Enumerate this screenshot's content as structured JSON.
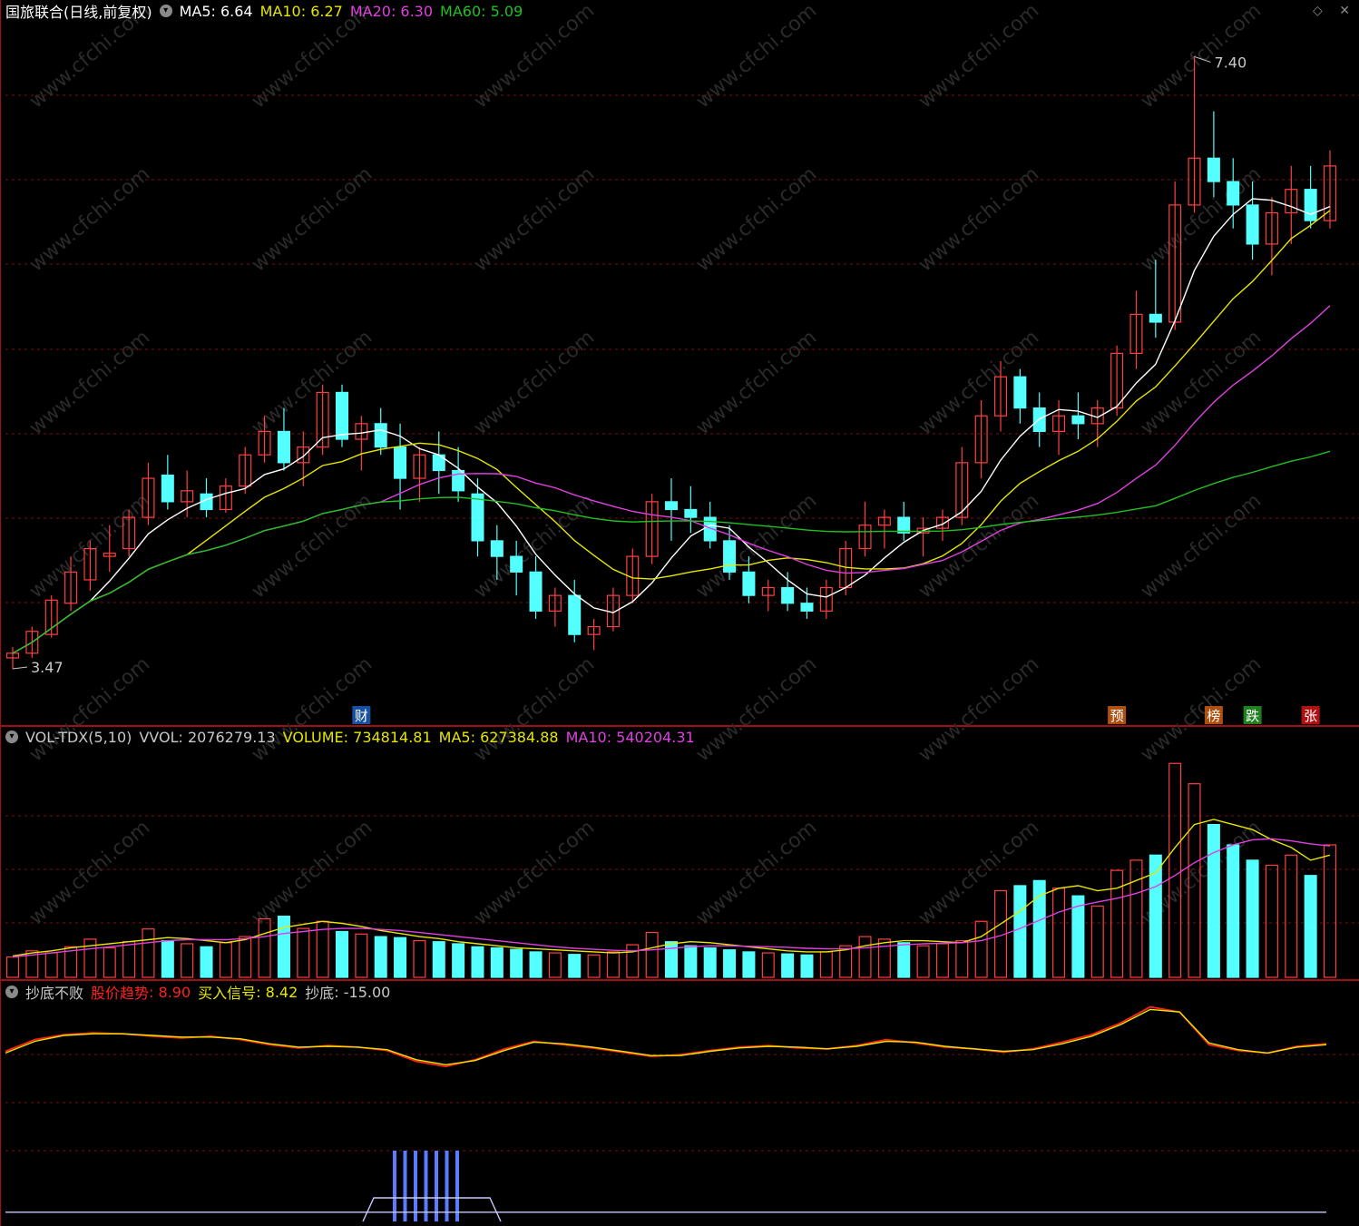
{
  "colors": {
    "up": "#ff4040",
    "down": "#54ffff",
    "ma5": "#ffffff",
    "ma10": "#e6e600",
    "ma20": "#e040e0",
    "ma60": "#20c020",
    "grid": "#7a1010",
    "trend": "#ff2020",
    "signal": "#e6e600"
  },
  "header": {
    "title": "国旅联合(日线,前复权)",
    "ma5": "MA5: 6.64",
    "ma10": "MA10: 6.27",
    "ma20": "MA20: 6.30",
    "ma60": "MA60: 5.09"
  },
  "vol_header": {
    "name": "VOL-TDX(5,10)",
    "vvol": "VVOL: 2076279.13",
    "volume": "VOLUME: 734814.81",
    "ma5": "MA5: 627384.88",
    "ma10": "MA10: 540204.31"
  },
  "ind_header": {
    "name": "抄底不败",
    "trend_label": "股价趋势",
    "trend_value": ": 8.90",
    "signal_label": "买入信号",
    "signal_value": ": 8.42",
    "bottom_label": "抄底",
    "bottom_value": ": -15.00"
  },
  "top_icons": {
    "diamond": "◇",
    "close": "✕"
  },
  "chart_data": [
    {
      "type": "candlestick",
      "high_label": "7.40",
      "low_label": "3.47",
      "candles": [
        [
          3.55,
          3.62,
          3.48,
          3.58
        ],
        [
          3.58,
          3.75,
          3.55,
          3.72
        ],
        [
          3.7,
          3.95,
          3.68,
          3.92
        ],
        [
          3.9,
          4.2,
          3.85,
          4.1
        ],
        [
          4.05,
          4.3,
          3.98,
          4.25
        ],
        [
          4.2,
          4.4,
          4.1,
          4.22
        ],
        [
          4.25,
          4.5,
          4.2,
          4.45
        ],
        [
          4.45,
          4.8,
          4.4,
          4.7
        ],
        [
          4.72,
          4.85,
          4.5,
          4.55
        ],
        [
          4.55,
          4.75,
          4.45,
          4.62
        ],
        [
          4.6,
          4.7,
          4.45,
          4.5
        ],
        [
          4.5,
          4.7,
          4.48,
          4.65
        ],
        [
          4.65,
          4.9,
          4.6,
          4.85
        ],
        [
          4.85,
          5.1,
          4.8,
          5.0
        ],
        [
          5.0,
          5.15,
          4.75,
          4.8
        ],
        [
          4.8,
          5.0,
          4.65,
          4.9
        ],
        [
          4.9,
          5.3,
          4.85,
          5.25
        ],
        [
          5.25,
          5.3,
          4.9,
          4.95
        ],
        [
          4.95,
          5.1,
          4.75,
          5.05
        ],
        [
          5.05,
          5.15,
          4.85,
          4.9
        ],
        [
          4.9,
          5.05,
          4.5,
          4.7
        ],
        [
          4.7,
          4.9,
          4.55,
          4.85
        ],
        [
          4.85,
          5.0,
          4.6,
          4.75
        ],
        [
          4.75,
          4.9,
          4.55,
          4.62
        ],
        [
          4.6,
          4.7,
          4.2,
          4.3
        ],
        [
          4.3,
          4.4,
          4.05,
          4.2
        ],
        [
          4.2,
          4.3,
          3.95,
          4.1
        ],
        [
          4.1,
          4.2,
          3.8,
          3.85
        ],
        [
          3.85,
          4.0,
          3.75,
          3.95
        ],
        [
          3.95,
          4.05,
          3.65,
          3.7
        ],
        [
          3.7,
          3.8,
          3.6,
          3.75
        ],
        [
          3.75,
          4.0,
          3.72,
          3.95
        ],
        [
          3.95,
          4.25,
          3.9,
          4.2
        ],
        [
          4.2,
          4.6,
          4.15,
          4.55
        ],
        [
          4.55,
          4.7,
          4.3,
          4.5
        ],
        [
          4.5,
          4.65,
          4.35,
          4.45
        ],
        [
          4.45,
          4.55,
          4.25,
          4.3
        ],
        [
          4.3,
          4.4,
          4.05,
          4.1
        ],
        [
          4.1,
          4.2,
          3.9,
          3.95
        ],
        [
          3.95,
          4.05,
          3.85,
          4.0
        ],
        [
          4.0,
          4.1,
          3.85,
          3.9
        ],
        [
          3.9,
          4.0,
          3.8,
          3.85
        ],
        [
          3.85,
          4.05,
          3.8,
          4.0
        ],
        [
          4.0,
          4.3,
          3.95,
          4.25
        ],
        [
          4.25,
          4.55,
          4.2,
          4.4
        ],
        [
          4.4,
          4.5,
          4.25,
          4.45
        ],
        [
          4.45,
          4.55,
          4.3,
          4.35
        ],
        [
          4.35,
          4.45,
          4.2,
          4.38
        ],
        [
          4.38,
          4.5,
          4.3,
          4.45
        ],
        [
          4.45,
          4.9,
          4.4,
          4.8
        ],
        [
          4.8,
          5.2,
          4.7,
          5.1
        ],
        [
          5.1,
          5.45,
          5.0,
          5.35
        ],
        [
          5.35,
          5.4,
          5.05,
          5.15
        ],
        [
          5.15,
          5.25,
          4.9,
          5.0
        ],
        [
          5.0,
          5.2,
          4.85,
          5.1
        ],
        [
          5.1,
          5.25,
          4.95,
          5.05
        ],
        [
          5.05,
          5.2,
          4.9,
          5.15
        ],
        [
          5.15,
          5.55,
          5.1,
          5.5
        ],
        [
          5.5,
          5.9,
          5.4,
          5.75
        ],
        [
          5.75,
          6.1,
          5.6,
          5.7
        ],
        [
          5.7,
          6.6,
          5.65,
          6.45
        ],
        [
          6.45,
          7.4,
          6.4,
          6.75
        ],
        [
          6.75,
          7.05,
          6.5,
          6.6
        ],
        [
          6.6,
          6.75,
          6.3,
          6.45
        ],
        [
          6.45,
          6.6,
          6.1,
          6.2
        ],
        [
          6.2,
          6.5,
          6.0,
          6.4
        ],
        [
          6.4,
          6.7,
          6.2,
          6.55
        ],
        [
          6.55,
          6.7,
          6.3,
          6.35
        ],
        [
          6.35,
          6.8,
          6.3,
          6.7
        ]
      ]
    },
    {
      "type": "bar",
      "volumes": [
        40,
        52,
        48,
        60,
        75,
        58,
        70,
        95,
        72,
        66,
        60,
        68,
        80,
        115,
        120,
        96,
        110,
        90,
        85,
        80,
        78,
        72,
        70,
        66,
        60,
        58,
        55,
        50,
        48,
        45,
        44,
        50,
        64,
        88,
        70,
        62,
        58,
        54,
        50,
        48,
        46,
        44,
        50,
        62,
        80,
        75,
        68,
        62,
        66,
        72,
        110,
        170,
        180,
        190,
        175,
        160,
        140,
        210,
        230,
        240,
        420,
        380,
        300,
        260,
        230,
        220,
        240,
        200,
        260
      ],
      "vol_ma5": [
        42,
        48,
        52,
        58,
        62,
        66,
        70,
        74,
        78,
        76,
        72,
        68,
        74,
        86,
        98,
        104,
        110,
        106,
        100,
        92,
        86,
        80,
        76,
        70,
        66,
        62,
        58,
        56,
        54,
        52,
        50,
        48,
        50,
        58,
        66,
        70,
        68,
        64,
        60,
        56,
        52,
        50,
        50,
        54,
        62,
        68,
        72,
        72,
        70,
        68,
        80,
        105,
        130,
        160,
        175,
        180,
        170,
        175,
        190,
        205,
        255,
        300,
        310,
        300,
        290,
        270,
        255,
        230,
        240
      ],
      "vol_ma10": [
        40,
        44,
        48,
        52,
        56,
        60,
        64,
        68,
        72,
        74,
        74,
        74,
        76,
        80,
        86,
        90,
        94,
        96,
        96,
        94,
        92,
        88,
        84,
        80,
        76,
        72,
        68,
        64,
        60,
        57,
        55,
        53,
        52,
        54,
        57,
        60,
        62,
        62,
        61,
        60,
        59,
        57,
        56,
        56,
        58,
        61,
        64,
        66,
        67,
        68,
        72,
        82,
        96,
        112,
        128,
        140,
        148,
        155,
        165,
        178,
        200,
        225,
        245,
        260,
        270,
        272,
        268,
        262,
        258
      ]
    },
    {
      "type": "line",
      "trend": [
        4.2,
        5.6,
        6.2,
        6.4,
        6.3,
        6.0,
        5.8,
        6.0,
        5.6,
        5.0,
        4.6,
        4.9,
        4.7,
        4.3,
        3.0,
        2.4,
        3.2,
        4.5,
        5.4,
        5.0,
        4.6,
        4.1,
        3.6,
        3.8,
        4.3,
        4.7,
        4.9,
        4.6,
        4.5,
        4.9,
        5.6,
        5.2,
        4.7,
        4.5,
        4.1,
        4.5,
        5.3,
        6.2,
        7.6,
        9.5,
        8.9,
        5.0,
        4.3,
        4.0,
        4.8,
        5.1
      ],
      "signal": [
        4.0,
        5.4,
        6.1,
        6.3,
        6.3,
        6.1,
        5.9,
        5.9,
        5.7,
        5.1,
        4.7,
        4.8,
        4.7,
        4.4,
        3.2,
        2.6,
        3.1,
        4.3,
        5.3,
        5.1,
        4.7,
        4.2,
        3.7,
        3.7,
        4.2,
        4.6,
        4.8,
        4.7,
        4.5,
        4.8,
        5.4,
        5.3,
        4.8,
        4.5,
        4.2,
        4.4,
        5.1,
        6.0,
        7.4,
        9.2,
        8.9,
        5.2,
        4.4,
        4.0,
        4.7,
        5.0
      ],
      "bottom": [
        -15,
        -15,
        -15,
        -15,
        -15,
        -15,
        -15,
        -15,
        -15,
        -15,
        -15,
        -15,
        -15,
        -15,
        -15,
        -15,
        -15,
        -15,
        -15,
        -15,
        -15,
        -15,
        -15,
        -15,
        -15,
        -15,
        -15,
        -15,
        -15,
        -15,
        -15,
        -15,
        -15,
        -15,
        -15,
        -15,
        -15,
        -15,
        -15,
        -15,
        -15,
        -15,
        -15,
        -15,
        -15,
        -15
      ]
    }
  ],
  "markers": [
    {
      "label": "财",
      "index": 18,
      "bg": "#1850a0",
      "fg": "#ffffff"
    },
    {
      "label": "预",
      "index": 57,
      "bg": "#b05010",
      "fg": "#ffffff"
    },
    {
      "label": "榜",
      "index": 62,
      "bg": "#b05010",
      "fg": "#ffffff"
    },
    {
      "label": "跌",
      "index": 64,
      "bg": "#208020",
      "fg": "#ffffff"
    },
    {
      "label": "张",
      "index": 67,
      "bg": "#b01010",
      "fg": "#ffffff"
    }
  ],
  "watermark": "www.cfchi.com"
}
